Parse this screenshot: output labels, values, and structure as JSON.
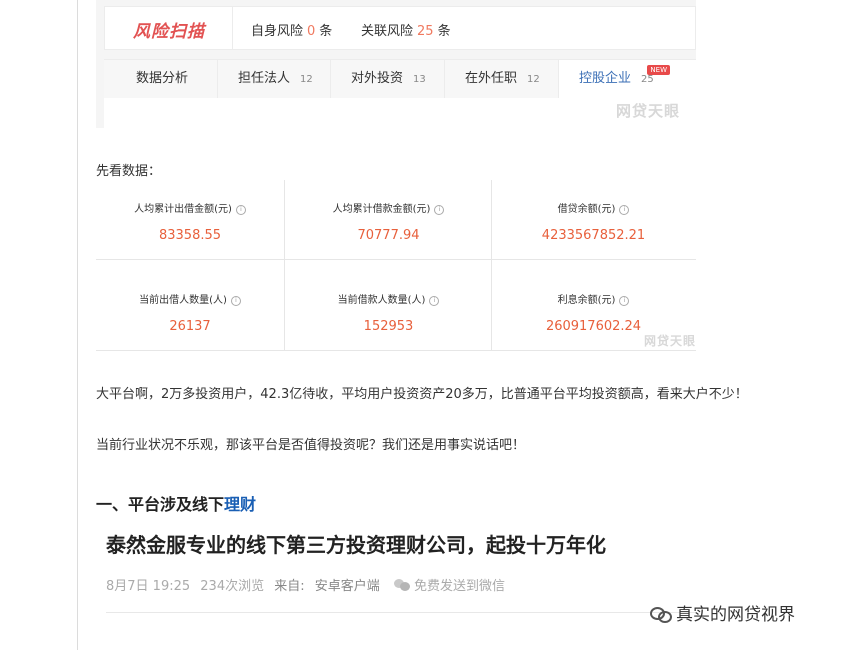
{
  "scan": {
    "title": "风险扫描",
    "self_risk_label": "自身风险",
    "self_risk_count": "0",
    "related_risk_label": "关联风险",
    "related_risk_count": "25",
    "unit": "条",
    "tabs": [
      {
        "label": "数据分析",
        "count": ""
      },
      {
        "label": "担任法人",
        "count": "12"
      },
      {
        "label": "对外投资",
        "count": "13"
      },
      {
        "label": "在外任职",
        "count": "12"
      },
      {
        "label": "控股企业",
        "count": "25",
        "badge": "NEW"
      }
    ],
    "watermark": "网贷天眼"
  },
  "lead_text": "先看数据：",
  "stats": [
    {
      "label": "人均累计出借金额(元)",
      "value": "83358.55"
    },
    {
      "label": "人均累计借款金额(元)",
      "value": "70777.94"
    },
    {
      "label": "借贷余额(元)",
      "value": "4233567852.21"
    },
    {
      "label": "当前出借人数量(人)",
      "value": "26137"
    },
    {
      "label": "当前借款人数量(人)",
      "value": "152953"
    },
    {
      "label": "利息余额(元)",
      "value": "260917602.24"
    }
  ],
  "stats_watermark": "网贷天眼",
  "paragraphs": [
    "大平台啊，2万多投资用户，42.3亿待收，平均用户投资资产20多万，比普通平台平均投资额高，看来大户不少！",
    "当前行业状况不乐观，那该平台是否值得投资呢？我们还是用事实说话吧！"
  ],
  "section_heading": {
    "prefix": "一、平台涉及线下",
    "highlight": "理财"
  },
  "article": {
    "title": "泰然金服专业的线下第三方投资理财公司，起投十万年化",
    "date": "8月7日 19:25",
    "views": "234次浏览",
    "from_label": "来自:",
    "source": "安卓客户端",
    "share": "免费发送到微信"
  },
  "signature": {
    "text": "真实的网贷视界"
  },
  "colors": {
    "accent_red": "#e25252",
    "value_orange": "#e8603c",
    "link_blue": "#1a5fb4",
    "active_tab": "#3b6fb6"
  }
}
